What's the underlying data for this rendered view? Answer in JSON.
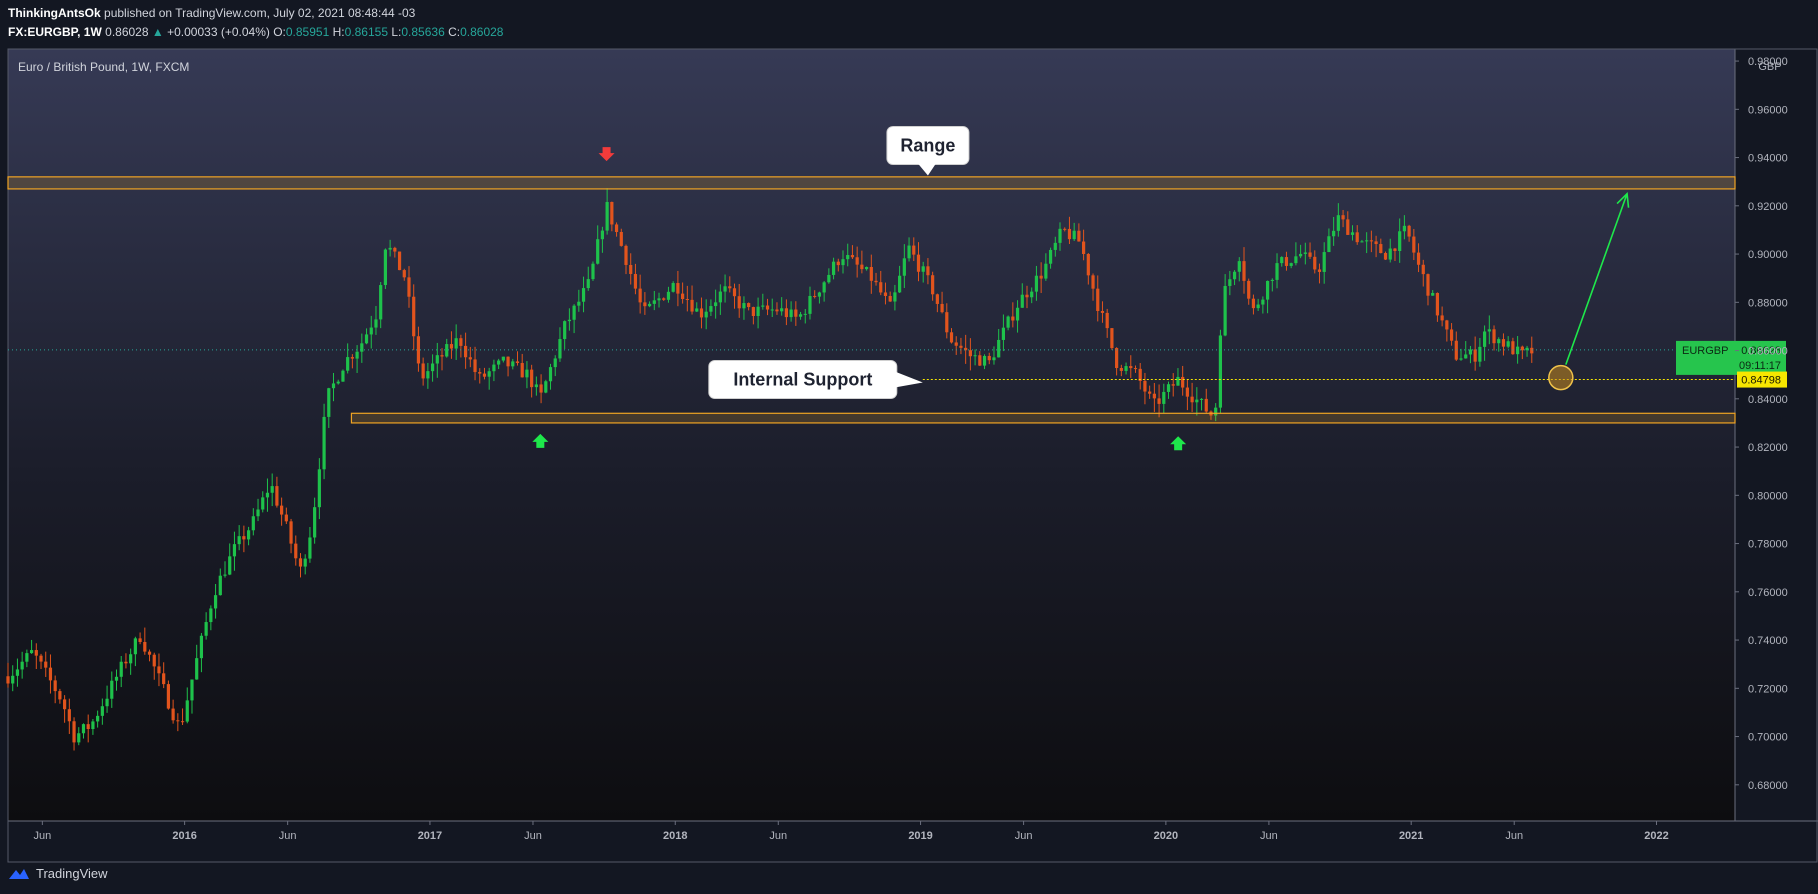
{
  "header": {
    "author": "ThinkingAntsOk",
    "published": "published on TradingView.com, July 02, 2021 08:48:44 -03",
    "symbol": "FX:EURGBP, 1W",
    "last": "0.86028",
    "change": "+0.00033 (+0.04%)",
    "o_label": "O:",
    "o_value": "0.85951",
    "h_label": "H:",
    "h_value": "0.86155",
    "l_label": "L:",
    "l_value": "0.85636",
    "c_label": "C:",
    "c_value": "0.86028"
  },
  "footer": {
    "brand": "TradingView"
  },
  "colors": {
    "up": "#1ec24b",
    "down": "#e2541d",
    "zone": "#f0a424",
    "background": "#131722"
  },
  "chart_data": {
    "type": "candlestick",
    "title": "Euro / British Pound, 1W, FXCM",
    "currency": "GBP",
    "ylim": [
      0.665,
      0.985
    ],
    "xlim": [
      2015.28,
      2022.32
    ],
    "y_ticks": [
      "0.98000",
      "0.96000",
      "0.94000",
      "0.92000",
      "0.90000",
      "0.88000",
      "0.86000",
      "0.84000",
      "0.82000",
      "0.80000",
      "0.78000",
      "0.76000",
      "0.74000",
      "0.72000",
      "0.70000",
      "0.68000"
    ],
    "x_ticks": [
      {
        "label": "Jun",
        "x": 2015.42
      },
      {
        "label": "2016",
        "x": 2016.0
      },
      {
        "label": "Jun",
        "x": 2016.42
      },
      {
        "label": "2017",
        "x": 2017.0
      },
      {
        "label": "Jun",
        "x": 2017.42
      },
      {
        "label": "2018",
        "x": 2018.0
      },
      {
        "label": "Jun",
        "x": 2018.42
      },
      {
        "label": "2019",
        "x": 2019.0
      },
      {
        "label": "Jun",
        "x": 2019.42
      },
      {
        "label": "2020",
        "x": 2020.0
      },
      {
        "label": "Jun",
        "x": 2020.42
      },
      {
        "label": "2021",
        "x": 2021.0
      },
      {
        "label": "Jun",
        "x": 2021.42
      },
      {
        "label": "2022",
        "x": 2022.0
      }
    ],
    "price_path": [
      [
        2015.28,
        0.725
      ],
      [
        2015.38,
        0.735
      ],
      [
        2015.5,
        0.715
      ],
      [
        2015.55,
        0.7
      ],
      [
        2015.62,
        0.705
      ],
      [
        2015.75,
        0.73
      ],
      [
        2015.82,
        0.742
      ],
      [
        2015.92,
        0.718
      ],
      [
        2015.98,
        0.703
      ],
      [
        2016.05,
        0.732
      ],
      [
        2016.12,
        0.76
      ],
      [
        2016.2,
        0.777
      ],
      [
        2016.28,
        0.789
      ],
      [
        2016.35,
        0.805
      ],
      [
        2016.42,
        0.785
      ],
      [
        2016.47,
        0.768
      ],
      [
        2016.52,
        0.788
      ],
      [
        2016.58,
        0.84
      ],
      [
        2016.65,
        0.855
      ],
      [
        2016.72,
        0.863
      ],
      [
        2016.78,
        0.875
      ],
      [
        2016.82,
        0.905
      ],
      [
        2016.9,
        0.89
      ],
      [
        2016.96,
        0.848
      ],
      [
        2017.05,
        0.858
      ],
      [
        2017.12,
        0.865
      ],
      [
        2017.2,
        0.848
      ],
      [
        2017.3,
        0.855
      ],
      [
        2017.4,
        0.85
      ],
      [
        2017.45,
        0.84
      ],
      [
        2017.55,
        0.87
      ],
      [
        2017.65,
        0.888
      ],
      [
        2017.72,
        0.92
      ],
      [
        2017.8,
        0.898
      ],
      [
        2017.87,
        0.875
      ],
      [
        2018.0,
        0.888
      ],
      [
        2018.1,
        0.875
      ],
      [
        2018.2,
        0.885
      ],
      [
        2018.3,
        0.876
      ],
      [
        2018.42,
        0.877
      ],
      [
        2018.5,
        0.873
      ],
      [
        2018.6,
        0.888
      ],
      [
        2018.68,
        0.9
      ],
      [
        2018.8,
        0.89
      ],
      [
        2018.88,
        0.877
      ],
      [
        2018.95,
        0.903
      ],
      [
        2019.05,
        0.885
      ],
      [
        2019.12,
        0.865
      ],
      [
        2019.2,
        0.858
      ],
      [
        2019.28,
        0.855
      ],
      [
        2019.32,
        0.864
      ],
      [
        2019.4,
        0.88
      ],
      [
        2019.5,
        0.893
      ],
      [
        2019.58,
        0.91
      ],
      [
        2019.65,
        0.905
      ],
      [
        2019.72,
        0.88
      ],
      [
        2019.8,
        0.855
      ],
      [
        2019.88,
        0.85
      ],
      [
        2019.95,
        0.837
      ],
      [
        2020.05,
        0.848
      ],
      [
        2020.12,
        0.84
      ],
      [
        2020.2,
        0.832
      ],
      [
        2020.23,
        0.882
      ],
      [
        2020.3,
        0.9
      ],
      [
        2020.35,
        0.875
      ],
      [
        2020.45,
        0.895
      ],
      [
        2020.55,
        0.9
      ],
      [
        2020.62,
        0.893
      ],
      [
        2020.7,
        0.915
      ],
      [
        2020.8,
        0.905
      ],
      [
        2020.9,
        0.9
      ],
      [
        2020.98,
        0.91
      ],
      [
        2021.03,
        0.895
      ],
      [
        2021.1,
        0.878
      ],
      [
        2021.18,
        0.858
      ],
      [
        2021.26,
        0.858
      ],
      [
        2021.3,
        0.868
      ],
      [
        2021.35,
        0.865
      ],
      [
        2021.45,
        0.858
      ],
      [
        2021.5,
        0.86
      ]
    ],
    "zones": [
      {
        "name": "range",
        "y_low": 0.927,
        "y_high": 0.932,
        "x_start": 2015.28,
        "x_end": 2022.32
      },
      {
        "name": "support",
        "y_low": 0.83,
        "y_high": 0.834,
        "x_start": 2016.68,
        "x_end": 2022.32
      }
    ],
    "internal_support_level": 0.84798,
    "annotations": [
      {
        "text": "Range",
        "x": 2019.03,
        "y": 0.945
      },
      {
        "text": "Internal Support",
        "x": 2018.52,
        "y": 0.848
      }
    ],
    "markers": [
      {
        "type": "down",
        "x": 2017.72,
        "y": 0.941,
        "color": "#f23b3b"
      },
      {
        "type": "up",
        "x": 2017.45,
        "y": 0.823,
        "color": "#1ee84b"
      },
      {
        "type": "up",
        "x": 2020.05,
        "y": 0.822,
        "color": "#1ee84b"
      }
    ],
    "projection": {
      "circle": [
        2021.61,
        0.8488
      ],
      "arrow_to": [
        2021.88,
        0.925
      ]
    },
    "price_tags": [
      {
        "name": "EURGBP",
        "value": "0.86028",
        "timer": "09:11:17",
        "y": 0.86028,
        "color": "#26c54d"
      },
      {
        "name": "",
        "value": "0.84798",
        "y": 0.84798,
        "color": "#f7e600"
      }
    ]
  }
}
